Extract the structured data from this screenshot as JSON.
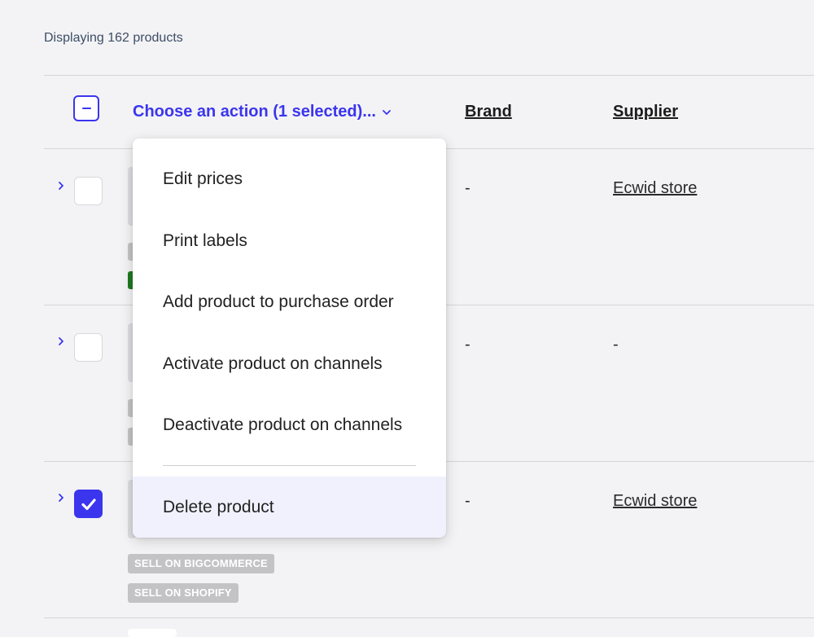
{
  "summary": "Displaying 162 products",
  "header": {
    "action_label": "Choose an action (1 selected)...",
    "brand": "Brand",
    "supplier": "Supplier"
  },
  "action_menu": {
    "items": [
      "Edit prices",
      "Print labels",
      "Add product to purchase order",
      "Activate product on channels",
      "Deactivate product on channels",
      "Delete product"
    ],
    "highlighted": "Delete product"
  },
  "rows": [
    {
      "brand": "-",
      "supplier": "Ecwid store",
      "checked": false
    },
    {
      "brand": "-",
      "supplier": "-",
      "checked": false
    },
    {
      "brand": "-",
      "supplier": "Ecwid store",
      "checked": true,
      "channels": [
        "SELL ON BIGCOMMERCE",
        "SELL ON SHOPIFY"
      ]
    }
  ],
  "colors": {
    "accent": "#3b35ee",
    "menu_hover": "#f0f1fd",
    "chip": "#c3c3c6",
    "status_green": "#1f7a1f"
  }
}
